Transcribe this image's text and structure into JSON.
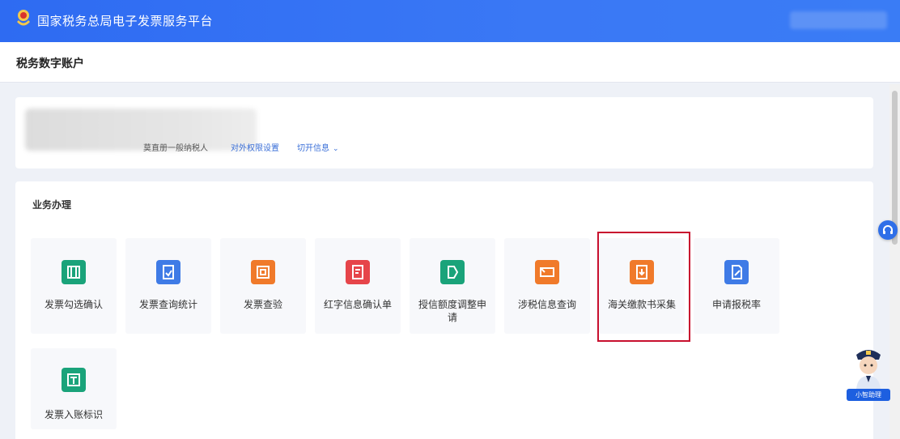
{
  "header": {
    "platform_title": "国家税务总局电子发票服务平台",
    "emblem_icon": "tax-emblem-icon"
  },
  "subheader": {
    "page_title": "税务数字账户"
  },
  "account": {
    "taxpayer_type": "莫直册一般纳税人",
    "link_settings": "对外权限设置",
    "link_switch": "切开信息",
    "chevron_icon": "chevron-down-icon"
  },
  "business": {
    "section_title": "业务办理",
    "tiles": [
      {
        "label": "发票勾选确认",
        "icon": "invoice-select-icon",
        "color": "#1aa37a"
      },
      {
        "label": "发票查询统计",
        "icon": "invoice-stats-icon",
        "color": "#3f7be6"
      },
      {
        "label": "发票查验",
        "icon": "invoice-verify-icon",
        "color": "#f07a2a"
      },
      {
        "label": "红字信息确认单",
        "icon": "red-info-icon",
        "color": "#e6454a"
      },
      {
        "label": "授信额度调整申请",
        "icon": "credit-adjust-icon",
        "color": "#1aa37a"
      },
      {
        "label": "涉税信息查询",
        "icon": "tax-info-icon",
        "color": "#f07a2a"
      },
      {
        "label": "海关缴款书采集",
        "icon": "customs-payment-icon",
        "color": "#f07a2a"
      },
      {
        "label": "申请报税率",
        "icon": "apply-rate-icon",
        "color": "#3f7be6"
      },
      {
        "label": "发票入账标识",
        "icon": "invoice-book-icon",
        "color": "#1aa37a"
      }
    ]
  },
  "assistant": {
    "badge_label": "小智助理",
    "avatar_icon": "police-assistant-avatar-icon"
  },
  "support_button": {
    "icon": "headset-icon"
  }
}
